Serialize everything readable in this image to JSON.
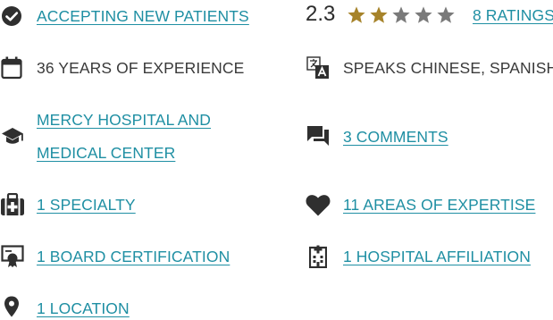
{
  "left": {
    "accepting": "ACCEPTING NEW PATIENTS",
    "experience": "36 YEARS OF EXPERIENCE",
    "hospital_line1": "MERCY HOSPITAL AND",
    "hospital_line2": "MEDICAL CENTER",
    "specialty": "1 SPECIALTY",
    "board": "1 BOARD CERTIFICATION",
    "location": "1 LOCATION"
  },
  "right": {
    "rating_value": "2.3",
    "rating_stars_filled": 2,
    "rating_stars_total": 5,
    "ratings_link": "8 RATINGS",
    "languages": "SPEAKS CHINESE, SPANISH",
    "comments": "3 COMMENTS",
    "expertise": "11 AREAS OF EXPERTISE",
    "affiliation": "1 HOSPITAL AFFILIATION"
  },
  "colors": {
    "link": "#1f8fa3",
    "icon": "#2f2f2f",
    "star_filled": "#a6832a",
    "star_empty": "#7a7a7a"
  },
  "icons": {
    "accepting": "check-circle-icon",
    "experience": "calendar-icon",
    "hospital": "graduation-cap-icon",
    "specialty": "medical-bag-icon",
    "board": "certificate-icon",
    "location": "map-pin-icon",
    "languages": "translate-icon",
    "comments": "chat-bubbles-icon",
    "expertise": "heart-icon",
    "affiliation": "hospital-building-icon"
  }
}
